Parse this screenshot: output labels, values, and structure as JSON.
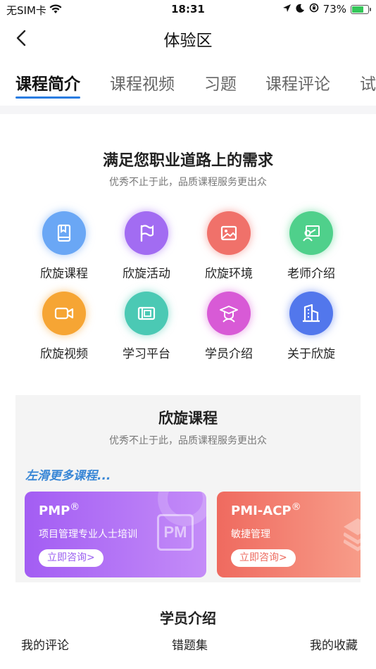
{
  "status_bar": {
    "carrier": "无SIM卡",
    "time": "18:31",
    "battery": "73%",
    "battery_level": 0.73
  },
  "nav": {
    "title": "体验区"
  },
  "tabs": [
    {
      "label": "课程简介",
      "active": true
    },
    {
      "label": "课程视频",
      "active": false
    },
    {
      "label": "习题",
      "active": false
    },
    {
      "label": "课程评论",
      "active": false
    },
    {
      "label": "试",
      "active": false
    }
  ],
  "needs_section": {
    "title": "满足您职业道路上的需求",
    "subtitle": "优秀不止于此，品质课程服务更出众",
    "items": [
      {
        "label": "欣旋课程",
        "icon": "book-icon",
        "color": "#6aa7f5"
      },
      {
        "label": "欣旋活动",
        "icon": "flag-icon",
        "color": "#a26cf2"
      },
      {
        "label": "欣旋环境",
        "icon": "image-icon",
        "color": "#f0716a"
      },
      {
        "label": "老师介绍",
        "icon": "teacher-icon",
        "color": "#4fd08b"
      },
      {
        "label": "欣旋视频",
        "icon": "video-icon",
        "color": "#f6a534"
      },
      {
        "label": "学习平台",
        "icon": "platform-icon",
        "color": "#4bc9b4"
      },
      {
        "label": "学员介绍",
        "icon": "graduate-icon",
        "color": "#d85ad6"
      },
      {
        "label": "关于欣旋",
        "icon": "building-icon",
        "color": "#5277ec"
      }
    ]
  },
  "courses_section": {
    "title": "欣旋课程",
    "subtitle": "优秀不止于此，品质课程服务更出众",
    "hint": "左滑更多课程...",
    "cards": [
      {
        "title": "PMP",
        "reg": "®",
        "desc": "项目管理专业人士培训",
        "button": "立即咨询>",
        "badge": "PM",
        "color_from": "#a35df3",
        "color_to": "#c48cf8"
      },
      {
        "title": "PMI-ACP",
        "reg": "®",
        "desc": "敏捷管理",
        "button": "立即咨询>",
        "color_from": "#ef6a5f",
        "color_to": "#f8a08c"
      }
    ]
  },
  "students_section": {
    "title": "学员介绍"
  },
  "bottom_links": [
    {
      "label": "我的评论"
    },
    {
      "label": "错题集"
    },
    {
      "label": "我的收藏"
    }
  ]
}
